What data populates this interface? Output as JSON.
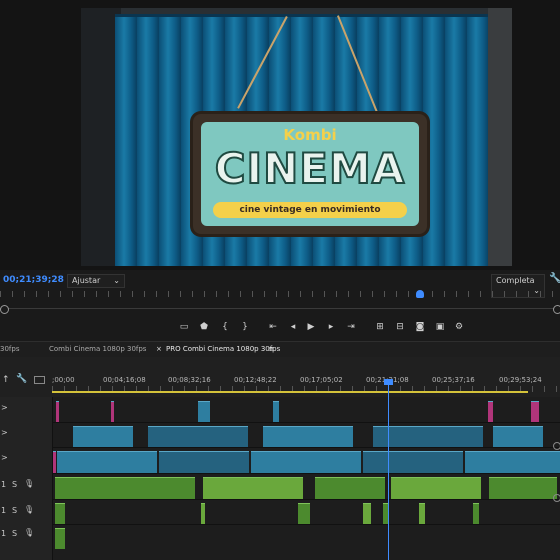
{
  "monitor": {
    "timecode": "00;21;39;28",
    "fit_select": "Ajustar",
    "quality_select": "Completa",
    "sign": {
      "top_text": "Kombi",
      "main_text": "CINEMA",
      "bottom_text": "cine vintage en movimiento"
    },
    "transport_icons": [
      "lift-icon",
      "extract-icon",
      "mark-in-icon",
      "mark-out-icon",
      "go-to-in-icon",
      "step-back-icon",
      "play-icon",
      "step-forward-icon",
      "go-to-out-icon",
      "insert-icon",
      "overwrite-icon",
      "export-frame-icon",
      "settings-icon"
    ]
  },
  "tabs": {
    "left_partial": "30fps",
    "tab1": "Combi Cinema 1080p 30fps",
    "tab2_close": "×",
    "tab2": "PRO Combi Cinema 1080p 30fps",
    "tab2_menu": "≡"
  },
  "ruler": {
    "labels": [
      ";00;00",
      "00;04;16;08",
      "00;08;32;16",
      "00;12;48;22",
      "00;17;05;02",
      "00;21;21;08",
      "00;25;37;16",
      "00;29;53;24"
    ]
  },
  "tracks": {
    "video_marks": [
      ">",
      ">",
      ">"
    ],
    "audio_rows": [
      {
        "num": "1",
        "s": "S"
      },
      {
        "num": "1",
        "s": "S"
      },
      {
        "num": "1",
        "s": "S"
      }
    ]
  },
  "colors": {
    "accent": "#3f8cff",
    "video_clip": "#2e7ea0",
    "audio_clip": "#4c8a2e",
    "marker_pink": "#b0357a"
  }
}
